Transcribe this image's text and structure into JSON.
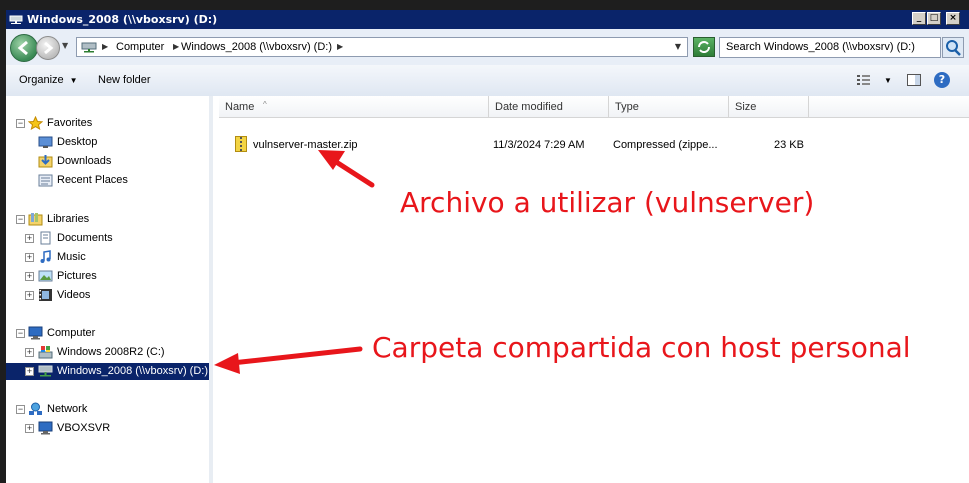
{
  "window": {
    "title": "Windows_2008 (\\\\vboxsrv) (D:)",
    "controls": {
      "minimize": "_",
      "maximize": "□",
      "close": "×"
    }
  },
  "address": {
    "crumbs": [
      "Computer",
      "Windows_2008 (\\\\vboxsrv) (D:)"
    ]
  },
  "search": {
    "placeholder": "Search Windows_2008 (\\\\vboxsrv) (D:)"
  },
  "toolbar": {
    "organize": "Organize",
    "new_folder": "New folder"
  },
  "nav": {
    "favorites": {
      "label": "Favorites",
      "items": [
        "Desktop",
        "Downloads",
        "Recent Places"
      ]
    },
    "libraries": {
      "label": "Libraries",
      "items": [
        "Documents",
        "Music",
        "Pictures",
        "Videos"
      ]
    },
    "computer": {
      "label": "Computer",
      "items": [
        "Windows 2008R2 (C:)",
        "Windows_2008 (\\\\vboxsrv) (D:)"
      ]
    },
    "network": {
      "label": "Network",
      "items": [
        "VBOXSVR"
      ]
    }
  },
  "columns": [
    "Name",
    "Date modified",
    "Type",
    "Size"
  ],
  "files": [
    {
      "name": "vulnserver-master.zip",
      "date": "11/3/2024 7:29 AM",
      "type": "Compressed (zippe...",
      "size": "23 KB"
    }
  ],
  "annotations": {
    "file": "Archivo a utilizar (vulnserver)",
    "share": "Carpeta compartida con host personal"
  },
  "colors": {
    "title_bar": "#0a246a",
    "annotation": "#e8161b",
    "selection": "#0a246a"
  }
}
